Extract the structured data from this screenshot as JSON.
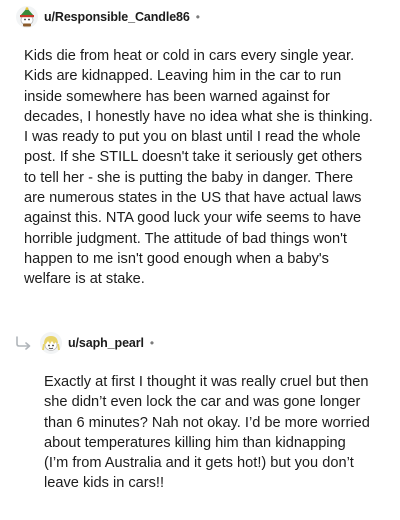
{
  "comments": [
    {
      "username": "u/Responsible_Candle86",
      "separator": "•",
      "avatar_icon": "snoo-avatar-green-hat-icon",
      "body": "Kids die from heat or cold in cars every single year. Kids are kidnapped. Leaving him in the car to run inside somewhere has been warned against for decades, I honestly have no idea what she is thinking. I was ready to put you on blast until I read the whole post. If she STILL doesn't take it seriously get others to tell her - she is putting the baby in danger. There are numerous states in the US that have actual laws against this. NTA good luck your wife seems to have horrible judgment. The attitude of bad things won't happen to me isn't good enough when a baby's welfare is at stake."
    },
    {
      "username": "u/saph_pearl",
      "separator": "•",
      "avatar_icon": "snoo-avatar-blonde-hair-icon",
      "reply_icon": "reply-arrow-icon",
      "body": "Exactly at first I thought it was really cruel but then she didn’t even lock the car and was gone longer than 6 minutes? Nah not okay. I’d be more worried about temperatures killing him than kidnapping (I’m from Australia and it gets hot!) but you don’t leave kids in cars!!"
    }
  ]
}
